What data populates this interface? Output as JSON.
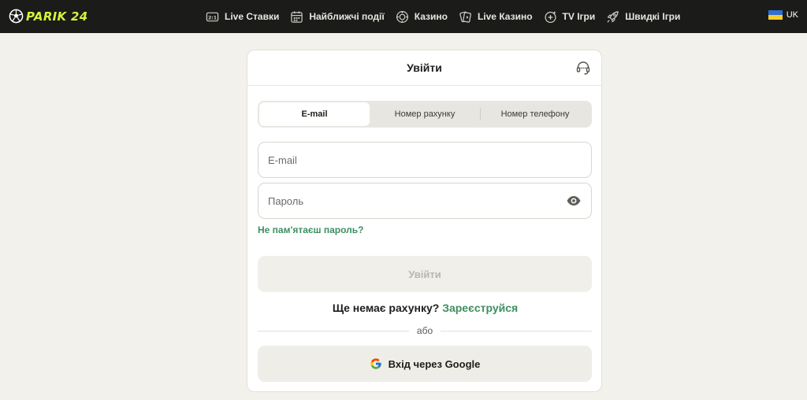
{
  "header": {
    "logo_text": "PARIK 24",
    "logo_icon": "soccer-ball-icon",
    "nav": [
      {
        "label": "Live Ставки",
        "icon": "live-score-icon"
      },
      {
        "label": "Найближчі події",
        "icon": "calendar-icon"
      },
      {
        "label": "Казино",
        "icon": "casino-chip-icon"
      },
      {
        "label": "Live Казино",
        "icon": "cards-icon"
      },
      {
        "label": "TV Ігри",
        "icon": "tv-games-icon"
      },
      {
        "label": "Швидкі Ігри",
        "icon": "rocket-icon"
      }
    ],
    "language": {
      "code": "UK",
      "icon": "ukraine-flag-icon"
    }
  },
  "login": {
    "title": "Увійти",
    "support_icon": "support-headset-icon",
    "tabs": [
      {
        "label": "E-mail",
        "active": true
      },
      {
        "label": "Номер рахунку",
        "active": false
      },
      {
        "label": "Номер телефону",
        "active": false
      }
    ],
    "email_placeholder": "E-mail",
    "email_value": "",
    "password_placeholder": "Пароль",
    "password_value": "",
    "password_toggle_icon": "eye-icon",
    "forgot_label": "Не пам'ятаєш пароль?",
    "submit_label": "Увійти",
    "register_text": "Ще немає рахунку?",
    "register_link": "Зареєструйся",
    "divider_text": "або",
    "google_label": "Вхід через Google",
    "google_icon": "google-icon"
  },
  "colors": {
    "header_bg": "#1b1b19",
    "logo_accent": "#d8f23a",
    "link_green": "#3d8f5f",
    "page_bg": "#f3f1ec"
  }
}
